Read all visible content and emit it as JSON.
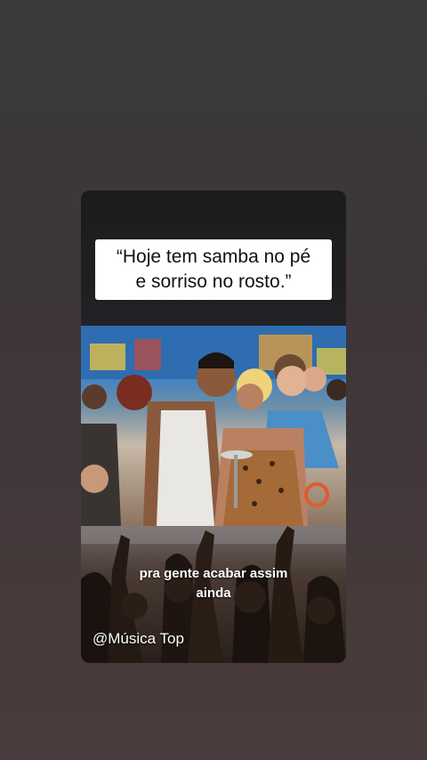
{
  "story": {
    "quote": "“Hoje tem samba no pé\ne sorriso no rosto.”",
    "subtitle": "pra gente acabar assim\nainda",
    "watermark": "@Música Top"
  },
  "colors": {
    "background": "#3d3638",
    "quote_box": "#ffffff",
    "quote_text": "#111111",
    "caption_text": "#ffffff"
  }
}
